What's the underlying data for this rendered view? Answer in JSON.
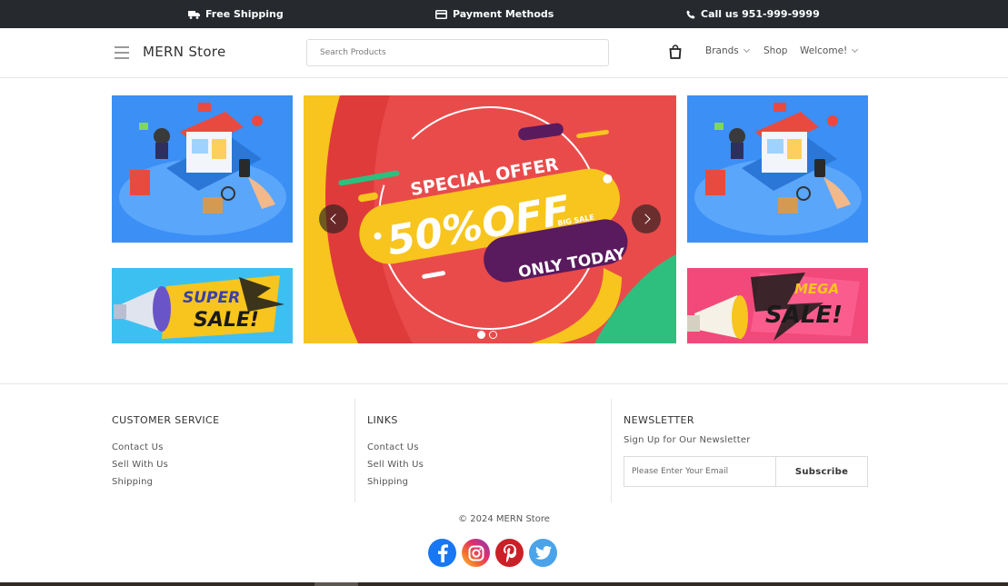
{
  "topbar": {
    "shipping": "Free Shipping",
    "payment": "Payment Methods",
    "call": "Call us 951-999-9999",
    "bg": "#262a2f"
  },
  "header": {
    "logo": "MERN Store",
    "search_placeholder": "Search Products",
    "nav": {
      "brands": "Brands",
      "shop": "Shop",
      "welcome": "Welcome!"
    },
    "icons": [
      "menu-icon",
      "cart-icon",
      "chevron-down-icon"
    ]
  },
  "banners": {
    "left_top": "isometric online shop illustration",
    "left_bottom_text": [
      "SUPER",
      "SALE!"
    ],
    "center": {
      "line1": "SPECIAL OFFER",
      "line2": "50%OFF",
      "line3": "BIG SALE",
      "line4": "ONLY TODAY",
      "slides": 2,
      "active_slide": 1
    },
    "right_top": "isometric online shop illustration",
    "right_bottom_text": [
      "MEGA",
      "SALE!"
    ]
  },
  "footer": {
    "customer_service": {
      "title": "CUSTOMER SERVICE",
      "links": [
        "Contact Us",
        "Sell With Us",
        "Shipping"
      ]
    },
    "links": {
      "title": "LINKS",
      "links": [
        "Contact Us",
        "Sell With Us",
        "Shipping"
      ]
    },
    "newsletter": {
      "title": "NEWSLETTER",
      "subtitle": "Sign Up for Our Newsletter",
      "placeholder": "Please Enter Your Email",
      "button": "Subscribe"
    },
    "copyright": "© 2024 MERN Store",
    "socials": [
      "facebook-icon",
      "instagram-icon",
      "pinterest-icon",
      "twitter-icon"
    ]
  },
  "colors": {
    "accent_red": "#e94b4b",
    "accent_yellow": "#f7c51e",
    "accent_purple": "#5a1a5e",
    "accent_green": "#2ebf7f",
    "blue_banner": "#3b8ff5",
    "pink_banner": "#f2497a"
  }
}
